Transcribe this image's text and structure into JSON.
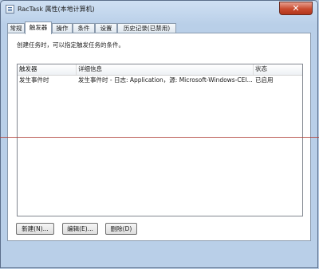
{
  "window": {
    "title": "RacTask 属性(本地计算机)",
    "close_glyph": "✕"
  },
  "tabs": [
    {
      "label": "常规"
    },
    {
      "label": "触发器",
      "active": true
    },
    {
      "label": "操作"
    },
    {
      "label": "条件"
    },
    {
      "label": "设置"
    },
    {
      "label": "历史记录(已禁用)"
    }
  ],
  "panel": {
    "description": "创建任务时，可以指定触发任务的条件。",
    "table": {
      "columns": [
        "触发器",
        "详细信息",
        "状态"
      ],
      "rows": [
        {
          "trigger": "发生事件时",
          "details": "发生事件时 - 日志: Application，源: Microsoft-Windows-CEI...",
          "status": "已启用"
        }
      ]
    }
  },
  "buttons": {
    "new": "新建(N)...",
    "edit": "编辑(E)...",
    "delete": "删除(D)"
  }
}
